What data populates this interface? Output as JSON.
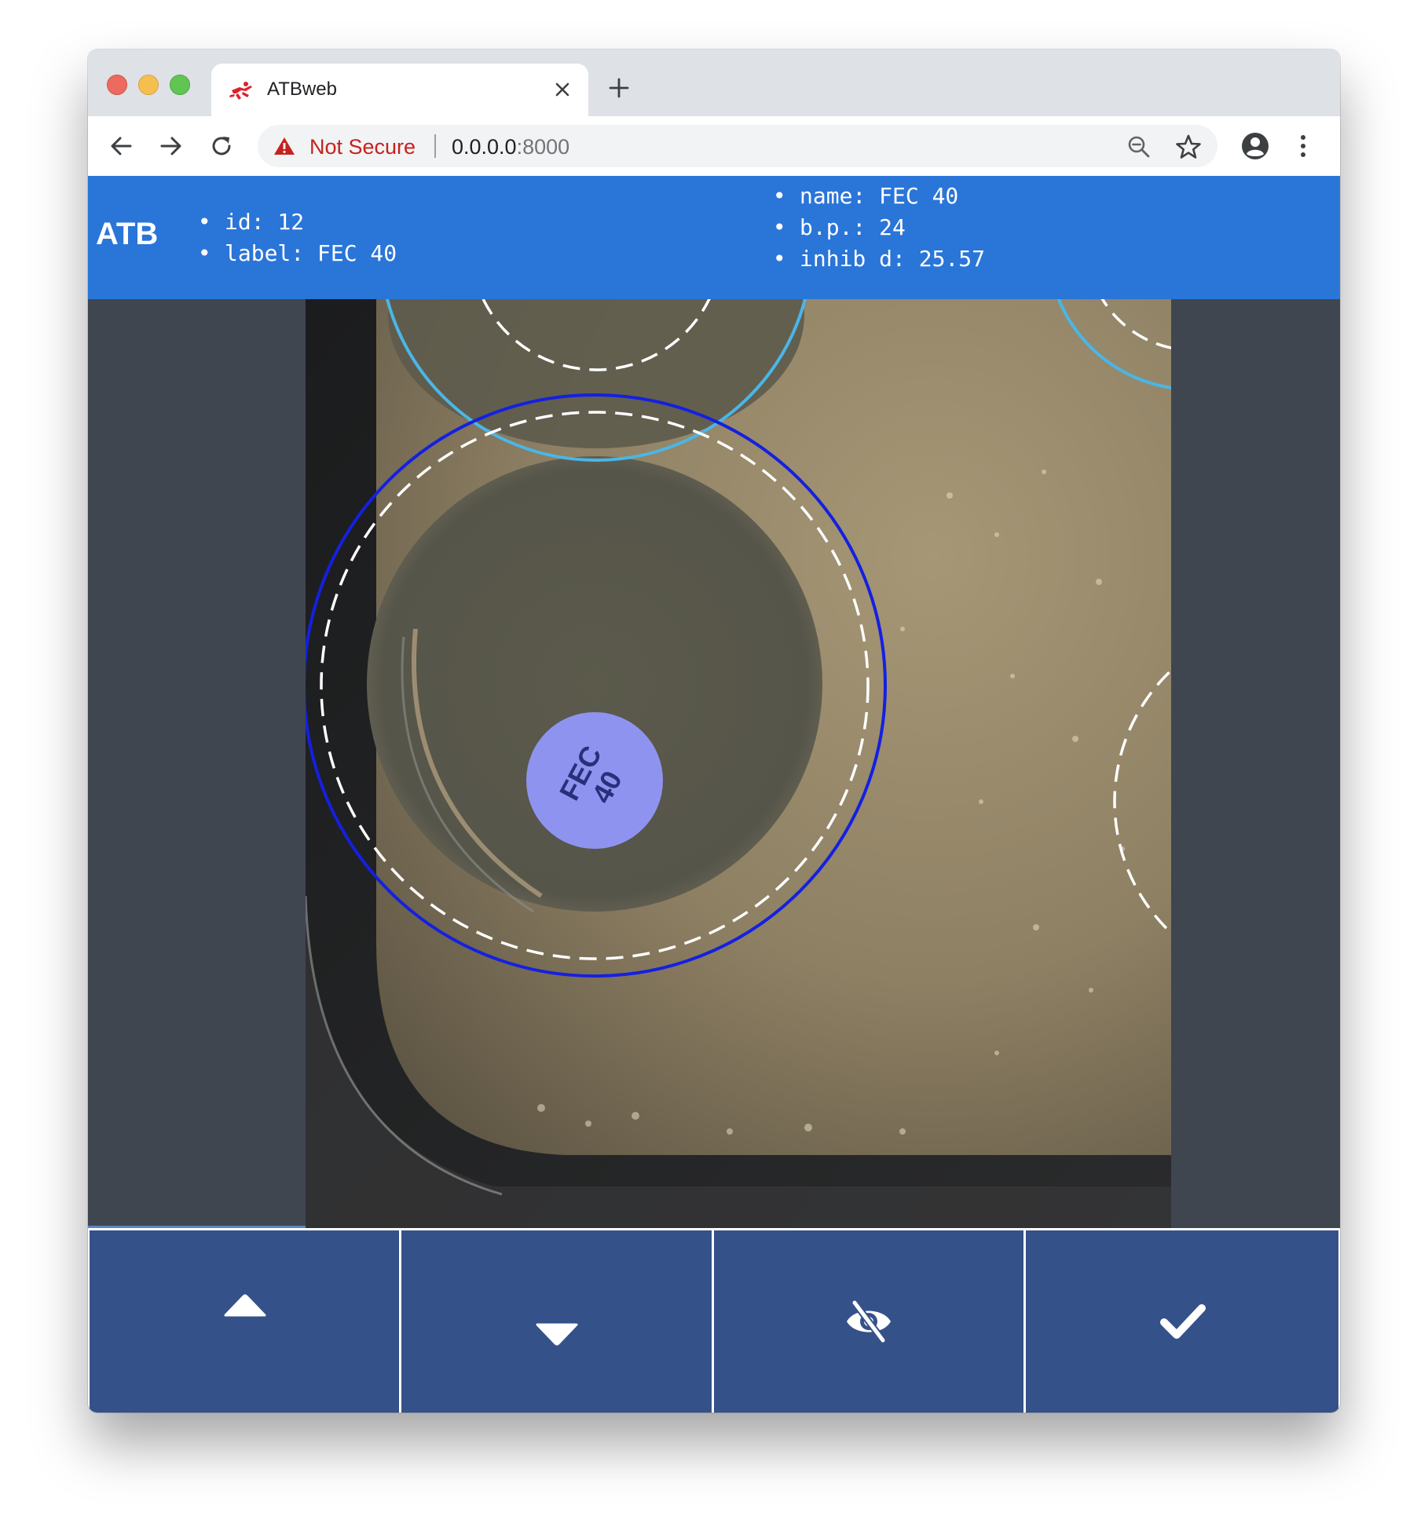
{
  "browser": {
    "tab_title": "ATBweb",
    "security_label": "Not Secure",
    "url_host": "0.0.0.0",
    "url_port": ":8000"
  },
  "header": {
    "brand": "ATB",
    "left_info": [
      {
        "text": "id: 12"
      },
      {
        "text": "label: FEC 40"
      }
    ],
    "right_info": [
      {
        "text": "name: FEC 40"
      },
      {
        "text": "b.p.: 24"
      },
      {
        "text": "inhib d: 25.57"
      }
    ]
  },
  "image": {
    "disk_label_line1": "FEC",
    "disk_label_line2": "40",
    "selected_circle_color": "#1420e0",
    "other_circle_color": "#4ab6e8",
    "disk_color": "#8f93f0"
  },
  "controls": [
    {
      "icon": "triangle-up-icon"
    },
    {
      "icon": "triangle-down-icon"
    },
    {
      "icon": "eye-slash-icon"
    },
    {
      "icon": "checkmark-icon"
    }
  ],
  "colors": {
    "header_bg": "#2a75d8",
    "panel_bg": "#3f4650",
    "button_bg": "#35518a"
  }
}
